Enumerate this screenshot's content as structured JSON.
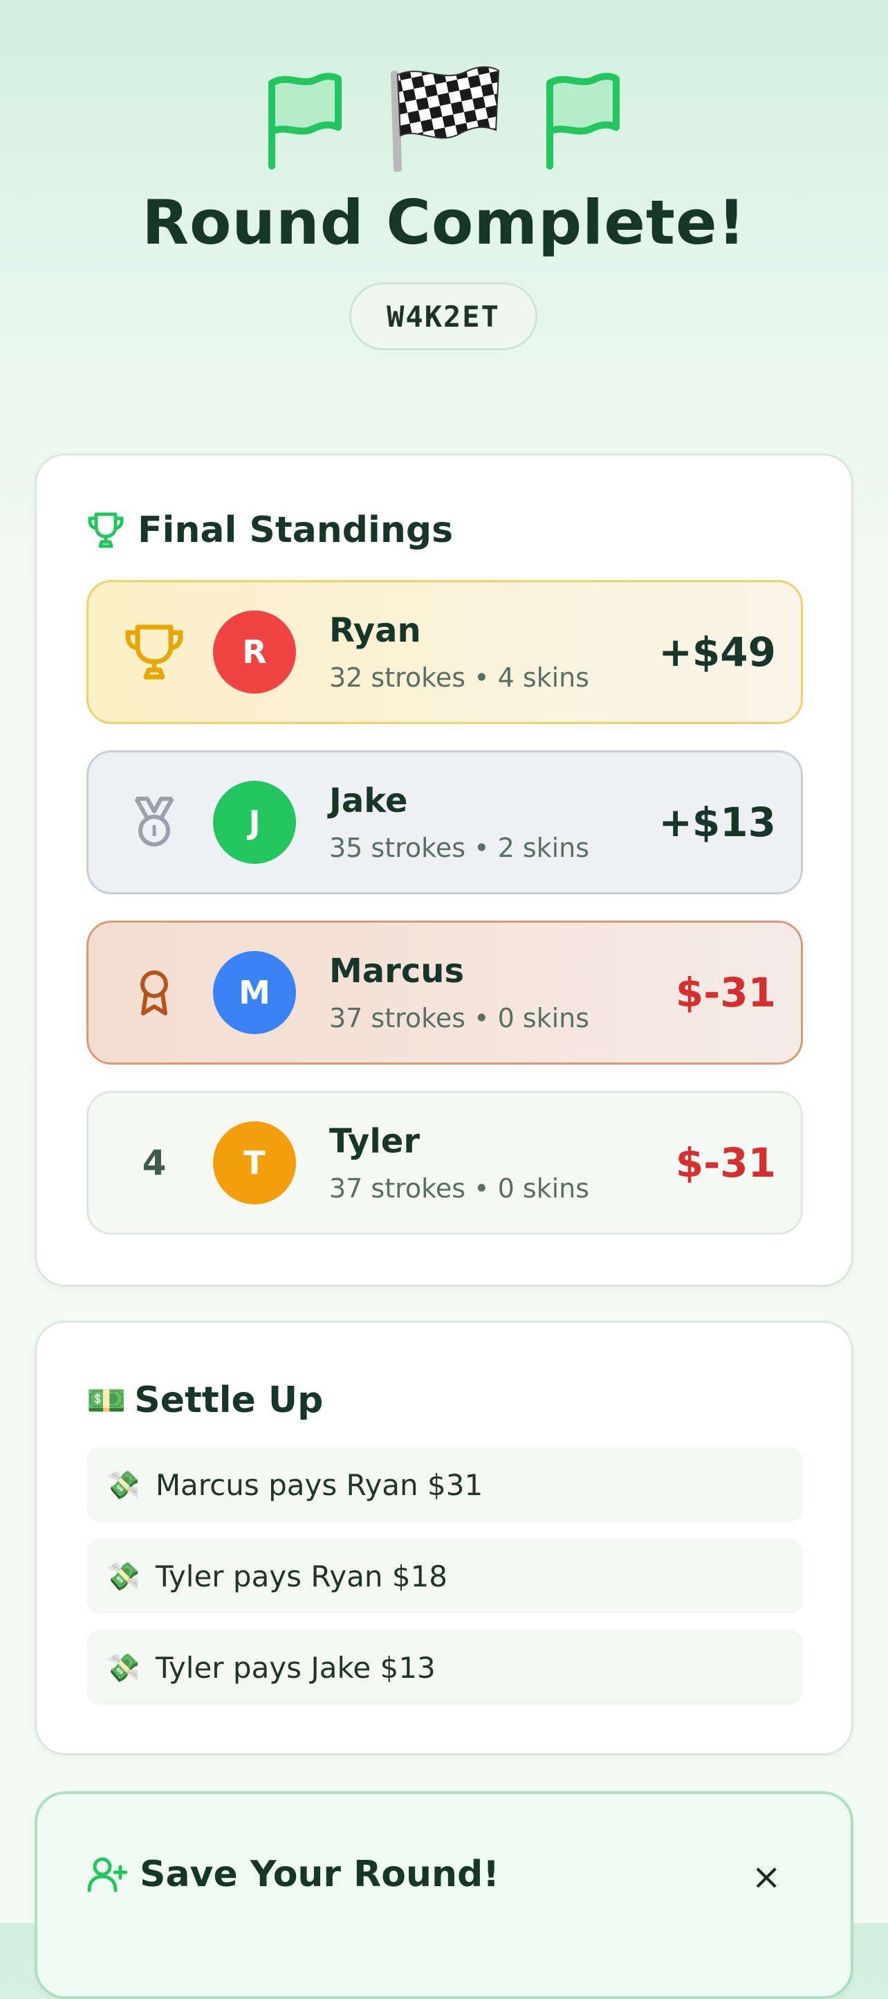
{
  "header": {
    "flags": [
      "green-flag-icon",
      "checkered-flag-icon",
      "green-flag-icon"
    ],
    "title": "Round Complete!",
    "round_code": "W4K2ET"
  },
  "standings": {
    "heading": "Final Standings",
    "players": [
      {
        "rank": "1",
        "rank_icon": "trophy-icon",
        "initial": "R",
        "name": "Ryan",
        "stats": "32 strokes • 4 skins",
        "amount": "+$49",
        "avatar_color": "#ef4444"
      },
      {
        "rank": "2",
        "rank_icon": "medal-icon",
        "initial": "J",
        "name": "Jake",
        "stats": "35 strokes • 2 skins",
        "amount": "+$13",
        "avatar_color": "#22c55e"
      },
      {
        "rank": "3",
        "rank_icon": "award-icon",
        "initial": "M",
        "name": "Marcus",
        "stats": "37 strokes • 0 skins",
        "amount": "$-31",
        "avatar_color": "#3b82f6"
      },
      {
        "rank": "4",
        "rank_icon": "",
        "initial": "T",
        "name": "Tyler",
        "stats": "37 strokes • 0 skins",
        "amount": "$-31",
        "avatar_color": "#f59e0b"
      }
    ]
  },
  "settle": {
    "icon": "💵",
    "heading": "Settle Up",
    "payment_icon": "💸",
    "payments": [
      "Marcus pays Ryan $31",
      "Tyler pays Ryan $18",
      "Tyler pays Jake $13"
    ]
  },
  "save": {
    "heading": "Save Your Round!",
    "close_label": "×"
  },
  "colors": {
    "accent_green": "#22c55e",
    "negative_red": "#d52f2f",
    "gold": "#e6a700",
    "silver": "#9aa1ab",
    "bronze": "#b5531d"
  }
}
